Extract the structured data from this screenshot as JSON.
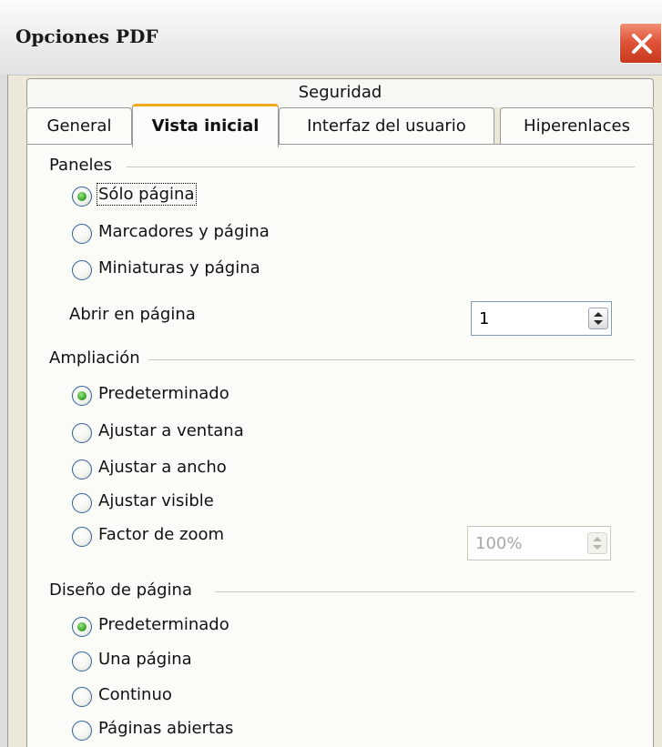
{
  "window": {
    "title": "Opciones PDF"
  },
  "tabs": {
    "top": "Seguridad",
    "general": "General",
    "vista_inicial": "Vista inicial",
    "interfaz": "Interfaz del usuario",
    "hiperenlaces": "Hiperenlaces",
    "active": "Vista inicial"
  },
  "paneles": {
    "title": "Paneles",
    "options": [
      {
        "label": "Sólo página",
        "checked": true
      },
      {
        "label": "Marcadores y página",
        "checked": false
      },
      {
        "label": "Miniaturas y página",
        "checked": false
      }
    ],
    "open_page_label": "Abrir en página",
    "open_page_value": "1"
  },
  "ampliacion": {
    "title": "Ampliación",
    "options": [
      {
        "label": "Predeterminado",
        "checked": true
      },
      {
        "label": "Ajustar a ventana",
        "checked": false
      },
      {
        "label": "Ajustar a ancho",
        "checked": false
      },
      {
        "label": "Ajustar visible",
        "checked": false
      },
      {
        "label": "Factor de zoom",
        "checked": false
      }
    ],
    "zoom_value": "100%"
  },
  "diseno": {
    "title": "Diseño de página",
    "options": [
      {
        "label": "Predeterminado",
        "checked": true
      },
      {
        "label": "Una página",
        "checked": false
      },
      {
        "label": "Continuo",
        "checked": false
      },
      {
        "label": "Páginas abiertas",
        "checked": false
      }
    ]
  },
  "colors": {
    "accent_tab": "#f2a91a",
    "radio_checked": "#3ea82d",
    "close_button": "#e0553a"
  }
}
